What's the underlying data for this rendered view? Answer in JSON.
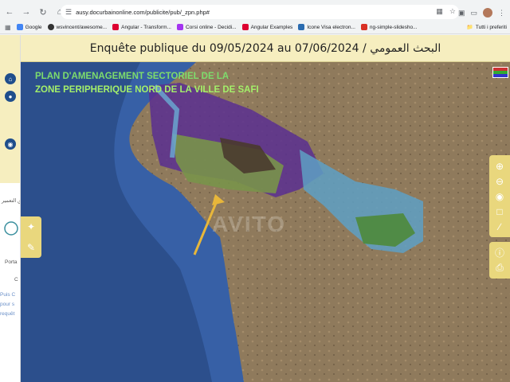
{
  "browser": {
    "url": "ausy.docurbainonline.com/publicite/pub/_zpn.php#",
    "bookmarks": [
      {
        "label": "Google",
        "color": "#4285f4"
      },
      {
        "label": "wsvincent/awesome...",
        "color": "#333333"
      },
      {
        "label": "Angular - Transform...",
        "color": "#dd0031"
      },
      {
        "label": "Corsi online - Decidi...",
        "color": "#a435f0"
      },
      {
        "label": "Angular Examples",
        "color": "#dd0031"
      },
      {
        "label": "Icone Visa electron...",
        "color": "#2b6cb0"
      },
      {
        "label": "ng-simple-slidesho...",
        "color": "#d93025"
      }
    ],
    "bookmarks_right": "Tutti i preferiti"
  },
  "left_panel": {
    "arabic_label": "اتق التعمير",
    "portal_label": "Porta",
    "c_label": "C",
    "text_lines": [
      "Puis C",
      "pour s",
      "requêt"
    ]
  },
  "title_bar": {
    "text": "Enquête publique du 09/05/2024 au 07/06/2024 / البحث العمومي"
  },
  "map": {
    "plan_line1": "PLAN D'AMENAGEMENT SECTORIEL DE LA",
    "plan_line2": "ZONE PERIPHERIQUE NORD DE LA VILLE DE SAFI",
    "watermark": "AVITO"
  },
  "icons": {
    "home": "home-icon",
    "globe": "globe-icon",
    "globe2": "globe-icon",
    "pin": "pin-icon",
    "pencil": "pencil-icon",
    "zoom_in": "zoom-in-icon",
    "zoom_out": "zoom-out-icon",
    "world": "world-icon",
    "square": "square-icon",
    "measure": "measure-icon",
    "info": "info-icon",
    "print": "print-icon"
  }
}
